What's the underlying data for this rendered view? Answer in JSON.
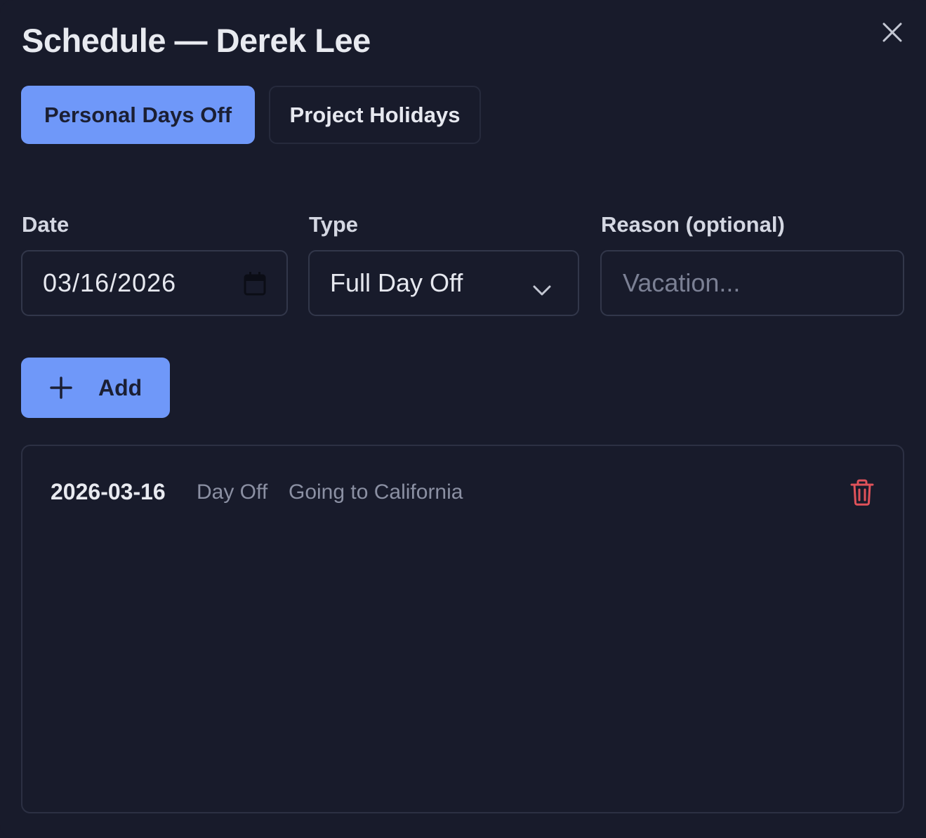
{
  "dialog": {
    "title": "Schedule — Derek Lee",
    "close_icon": "close-icon"
  },
  "tabs": [
    {
      "label": "Personal Days Off",
      "active": true
    },
    {
      "label": "Project Holidays",
      "active": false
    }
  ],
  "form": {
    "date_label": "Date",
    "date_value": "03/16/2026",
    "type_label": "Type",
    "type_value": "Full Day Off",
    "reason_label": "Reason (optional)",
    "reason_placeholder": "Vacation...",
    "reason_value": ""
  },
  "add_button": {
    "label": "Add",
    "icon": "plus-icon"
  },
  "entries": [
    {
      "date": "2026-03-16",
      "type": "Day Off",
      "reason": "Going to California",
      "delete_icon": "trash-icon"
    }
  ],
  "colors": {
    "background": "#181b2b",
    "accent": "#6f98f9",
    "danger": "#e0525a",
    "muted_text": "#8b90a3"
  }
}
